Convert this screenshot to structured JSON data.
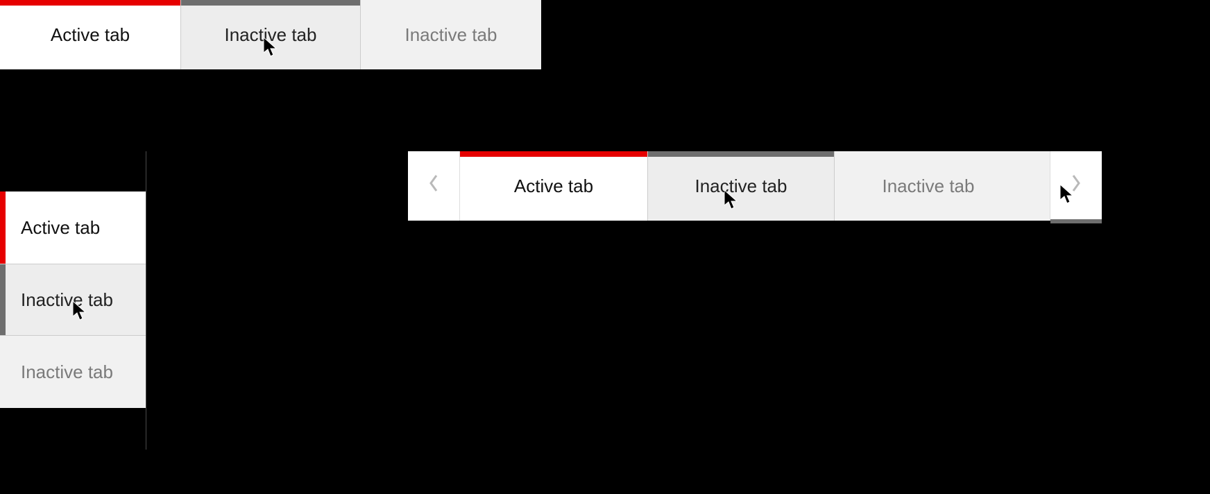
{
  "horizontal_tabs": {
    "items": [
      {
        "label": "Active tab",
        "state": "active"
      },
      {
        "label": "Inactive tab",
        "state": "hover"
      },
      {
        "label": "Inactive tab",
        "state": "inactive"
      }
    ]
  },
  "vertical_tabs": {
    "items": [
      {
        "label": "Active tab",
        "state": "active"
      },
      {
        "label": "Inactive tab",
        "state": "hover"
      },
      {
        "label": "Inactive tab",
        "state": "inactive"
      }
    ]
  },
  "scroll_tabs": {
    "prev_icon": "chevron-left",
    "next_icon": "chevron-right",
    "items": [
      {
        "label": "Active tab",
        "state": "active"
      },
      {
        "label": "Inactive tab",
        "state": "hover"
      },
      {
        "label": "Inactive tab",
        "state": "inactive"
      }
    ]
  },
  "colors": {
    "accent": "#e60000",
    "hover_bar": "#6e6e6e",
    "inactive_fg": "#7a7a7a"
  }
}
